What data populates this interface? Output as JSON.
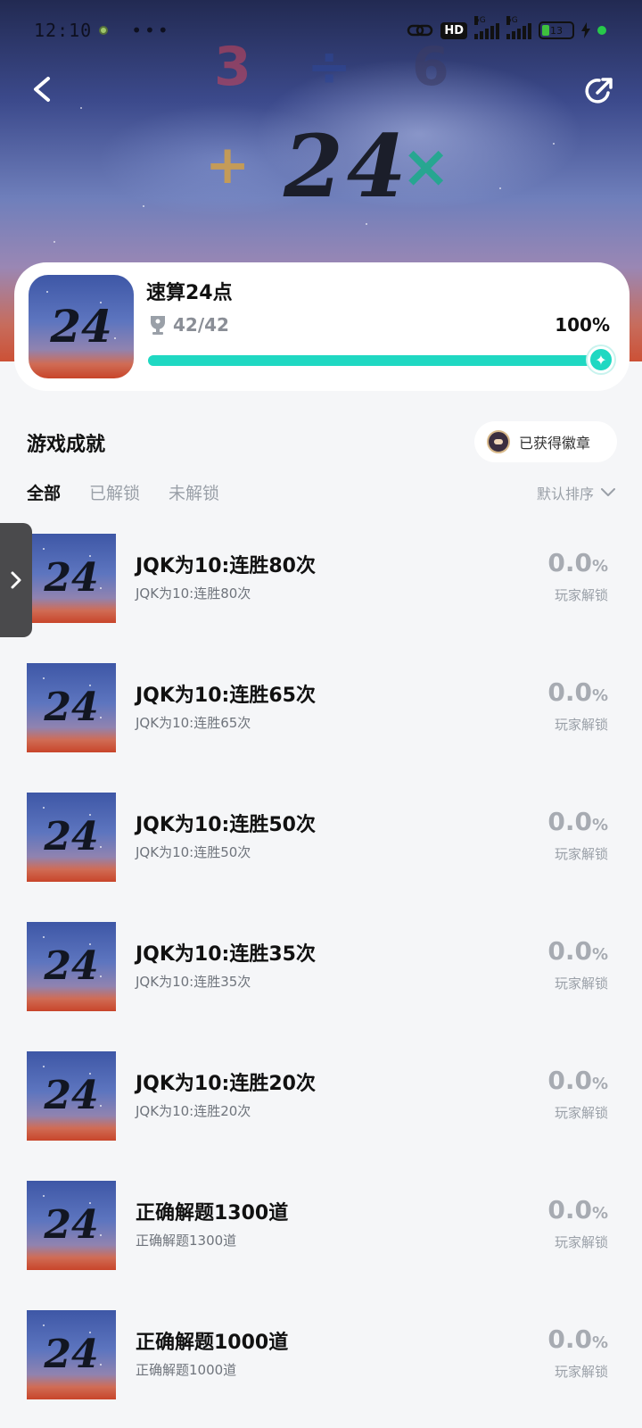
{
  "status_bar": {
    "time": "12:10",
    "dots": "•••",
    "hd": "HD",
    "net1": "5G",
    "net2": "5G",
    "battery": "13"
  },
  "hero": {
    "number": "24",
    "deco_3": "3",
    "deco_div": "÷",
    "deco_6": "6",
    "deco_plus": "+",
    "deco_times": "×"
  },
  "game": {
    "name": "速算24点",
    "icon_text": "24",
    "achievement_count": "42/42",
    "progress_percent": "100%",
    "progress_value": 1.0
  },
  "section": {
    "title": "游戏成就",
    "badge_button": "已获得徽章"
  },
  "tabs": [
    {
      "label": "全部",
      "active": true
    },
    {
      "label": "已解锁",
      "active": false
    },
    {
      "label": "未解锁",
      "active": false
    }
  ],
  "sort_label": "默认排序",
  "achievements": [
    {
      "title": "JQK为10:连胜80次",
      "subtitle": "JQK为10:连胜80次",
      "percent": "0.0",
      "unit": "%",
      "meta": "玩家解锁",
      "icon_text": "24"
    },
    {
      "title": "JQK为10:连胜65次",
      "subtitle": "JQK为10:连胜65次",
      "percent": "0.0",
      "unit": "%",
      "meta": "玩家解锁",
      "icon_text": "24"
    },
    {
      "title": "JQK为10:连胜50次",
      "subtitle": "JQK为10:连胜50次",
      "percent": "0.0",
      "unit": "%",
      "meta": "玩家解锁",
      "icon_text": "24"
    },
    {
      "title": "JQK为10:连胜35次",
      "subtitle": "JQK为10:连胜35次",
      "percent": "0.0",
      "unit": "%",
      "meta": "玩家解锁",
      "icon_text": "24"
    },
    {
      "title": "JQK为10:连胜20次",
      "subtitle": "JQK为10:连胜20次",
      "percent": "0.0",
      "unit": "%",
      "meta": "玩家解锁",
      "icon_text": "24"
    },
    {
      "title": "正确解题1300道",
      "subtitle": "正确解题1300道",
      "percent": "0.0",
      "unit": "%",
      "meta": "玩家解锁",
      "icon_text": "24"
    },
    {
      "title": "正确解题1000道",
      "subtitle": "正确解题1000道",
      "percent": "0.0",
      "unit": "%",
      "meta": "玩家解锁",
      "icon_text": "24"
    }
  ],
  "colors": {
    "accent": "#1fd8c2",
    "muted": "#a7abb2",
    "background": "#f5f6f8"
  }
}
